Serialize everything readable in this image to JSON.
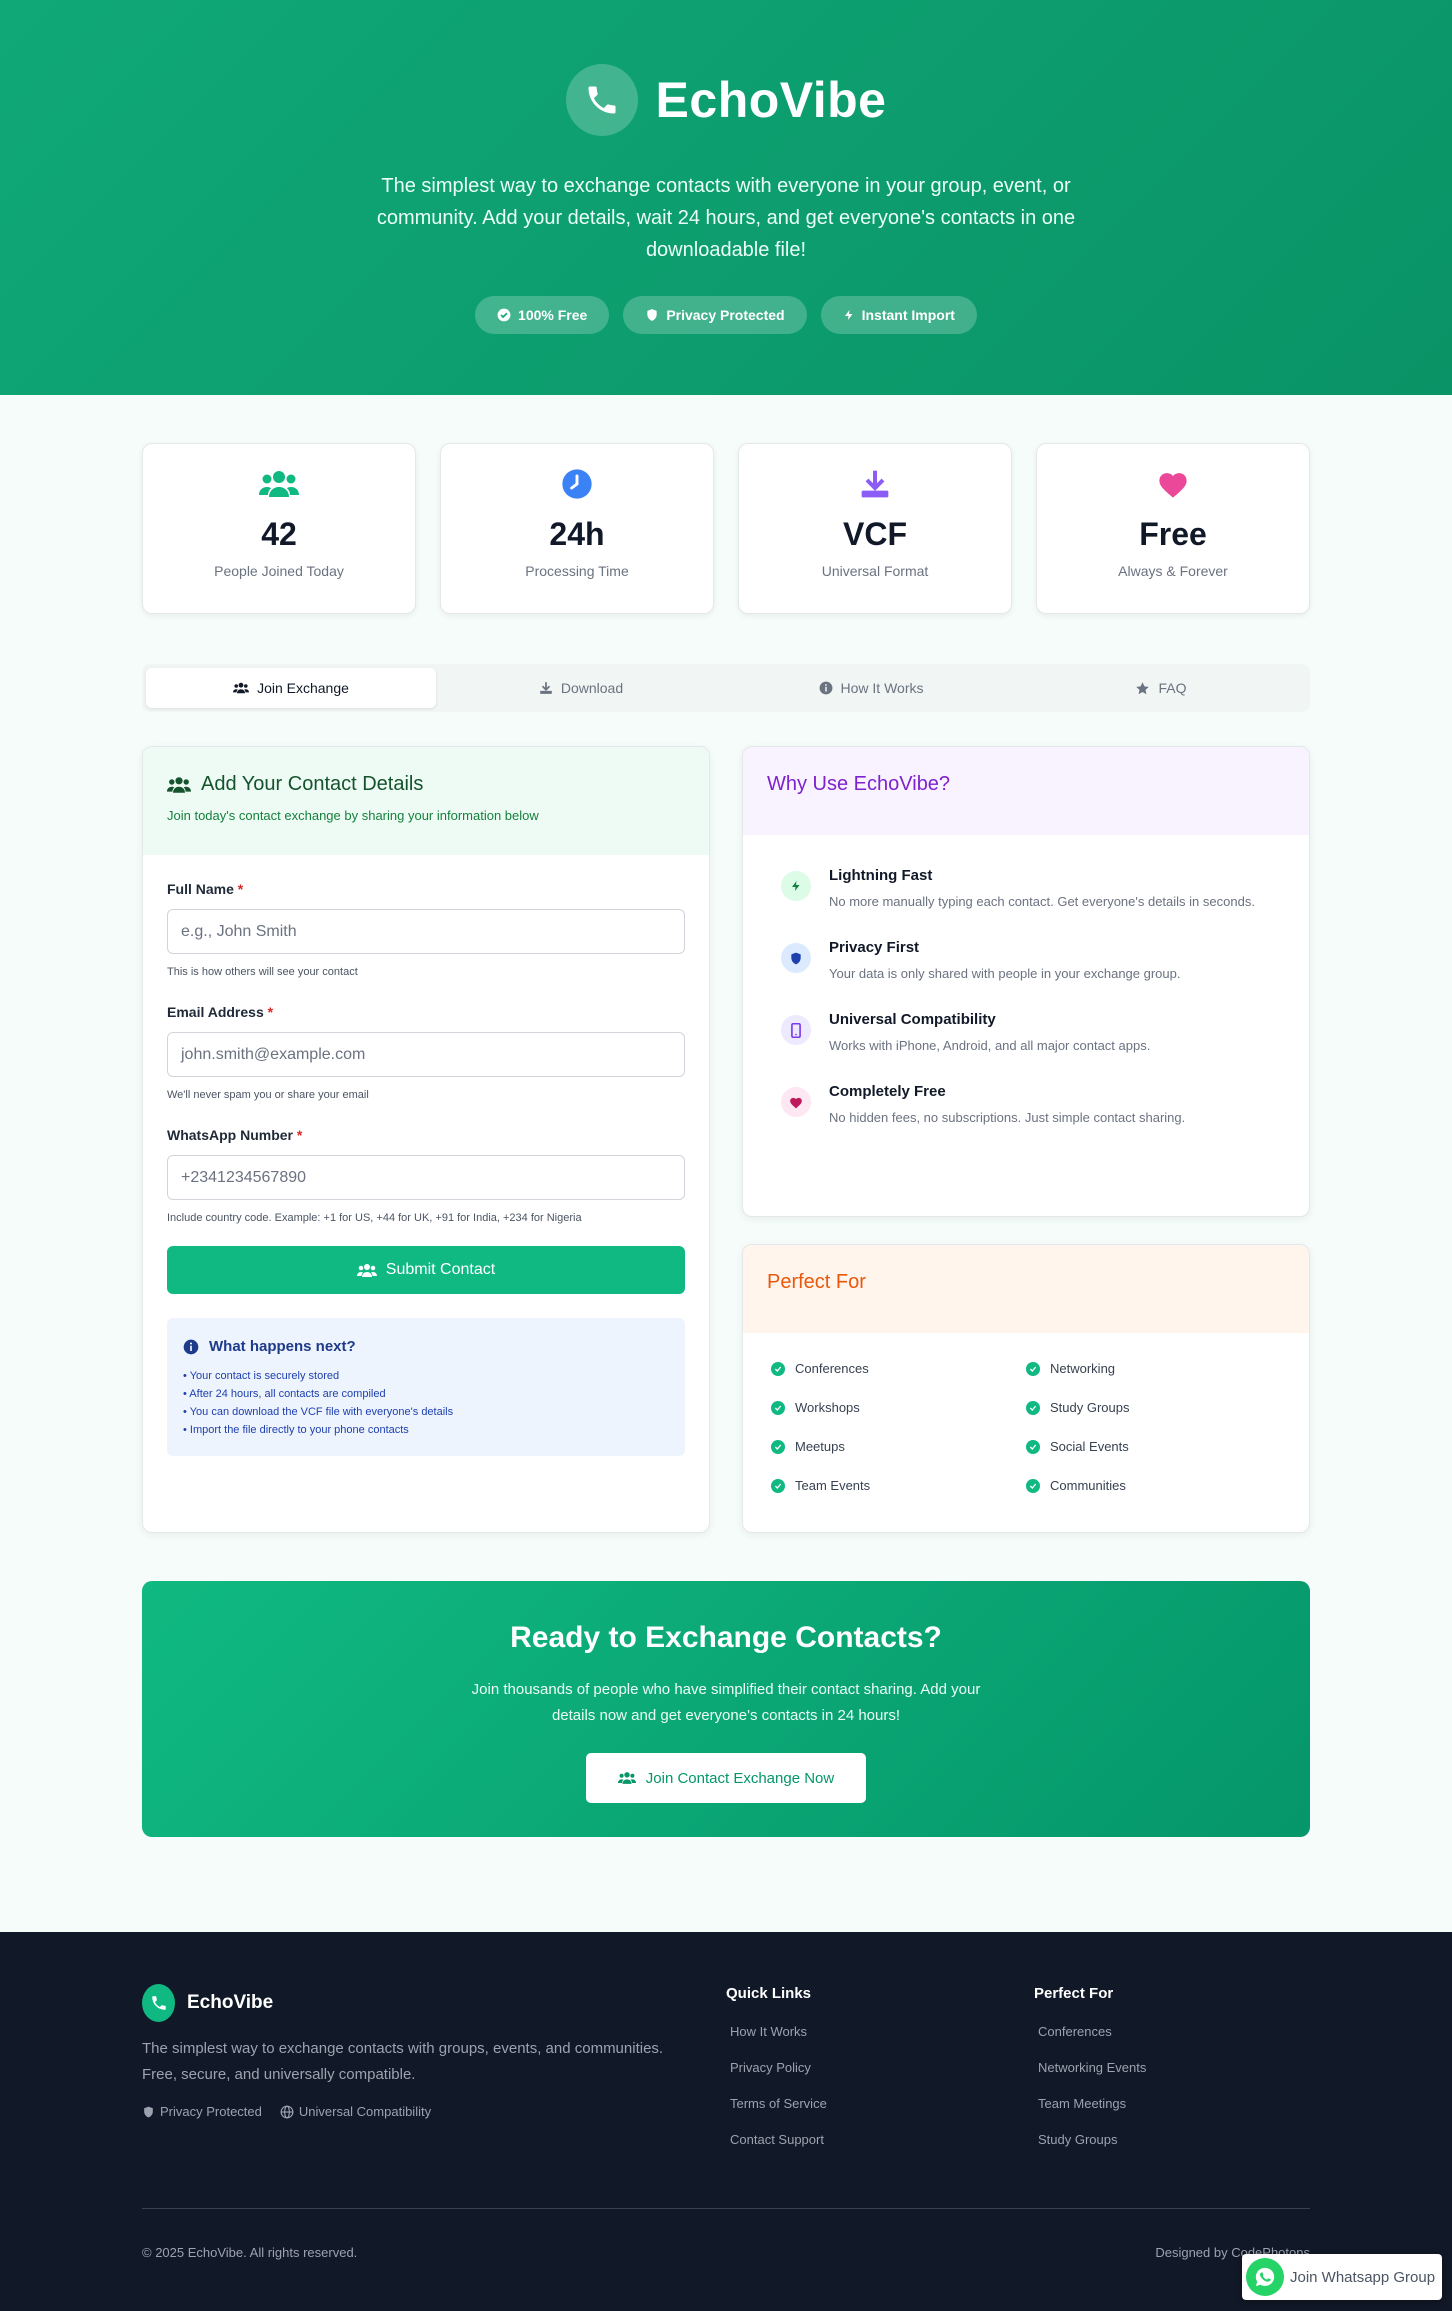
{
  "hero": {
    "title": "EchoVibe",
    "description": "The simplest way to exchange contacts with everyone in your group, event, or community. Add your details, wait 24 hours, and get everyone's contacts in one downloadable file!",
    "badges": [
      "100% Free",
      "Privacy Protected",
      "Instant Import"
    ]
  },
  "stats": [
    {
      "value": "42",
      "label": "People Joined Today",
      "icon": "users-icon",
      "color": "#10b981"
    },
    {
      "value": "24h",
      "label": "Processing Time",
      "icon": "clock-icon",
      "color": "#3b82f6"
    },
    {
      "value": "VCF",
      "label": "Universal Format",
      "icon": "download-icon",
      "color": "#8b5cf6"
    },
    {
      "value": "Free",
      "label": "Always & Forever",
      "icon": "heart-icon",
      "color": "#ec4899"
    }
  ],
  "tabs": [
    "Join Exchange",
    "Download",
    "How It Works",
    "FAQ"
  ],
  "form": {
    "title": "Add Your Contact Details",
    "subtitle": "Join today's contact exchange by sharing your information below",
    "name_label": "Full Name",
    "name_placeholder": "e.g., John Smith",
    "name_help": "This is how others will see your contact",
    "email_label": "Email Address",
    "email_placeholder": "john.smith@example.com",
    "email_help": "We'll never spam you or share your email",
    "phone_label": "WhatsApp Number",
    "phone_placeholder": "+2341234567890",
    "phone_help": "Include country code. Example: +1 for US, +44 for UK, +91 for India, +234 for Nigeria",
    "submit_label": "Submit Contact",
    "next_title": "What happens next?",
    "next_items": [
      "• Your contact is securely stored",
      "• After 24 hours, all contacts are compiled",
      "• You can download the VCF file with everyone's details",
      "• Import the file directly to your phone contacts"
    ]
  },
  "why": {
    "title": "Why Use EchoVibe?",
    "features": [
      {
        "title": "Lightning Fast",
        "desc": "No more manually typing each contact. Get everyone's details in seconds."
      },
      {
        "title": "Privacy First",
        "desc": "Your data is only shared with people in your exchange group."
      },
      {
        "title": "Universal Compatibility",
        "desc": "Works with iPhone, Android, and all major contact apps."
      },
      {
        "title": "Completely Free",
        "desc": "No hidden fees, no subscriptions. Just simple contact sharing."
      }
    ]
  },
  "perfect": {
    "title": "Perfect For",
    "items": [
      "Conferences",
      "Networking",
      "Workshops",
      "Study Groups",
      "Meetups",
      "Social Events",
      "Team Events",
      "Communities"
    ]
  },
  "cta": {
    "title": "Ready to Exchange Contacts?",
    "desc": "Join thousands of people who have simplified their contact sharing. Add your details now and get everyone's contacts in 24 hours!",
    "button": "Join Contact Exchange Now"
  },
  "footer": {
    "brand": "EchoVibe",
    "desc": "The simplest way to exchange contacts with groups, events, and communities. Free, secure, and universally compatible.",
    "tags": [
      "Privacy Protected",
      "Universal Compatibility"
    ],
    "quick_title": "Quick Links",
    "quick_links": [
      "How It Works",
      "Privacy Policy",
      "Terms of Service",
      "Contact Support"
    ],
    "perfect_title": "Perfect For",
    "perfect_links": [
      "Conferences",
      "Networking Events",
      "Team Meetings",
      "Study Groups"
    ],
    "copyright": "© 2025 EchoVibe. All rights reserved.",
    "designed": "Designed by CodePhotons"
  },
  "whatsapp_float": "Join Whatsapp Group"
}
